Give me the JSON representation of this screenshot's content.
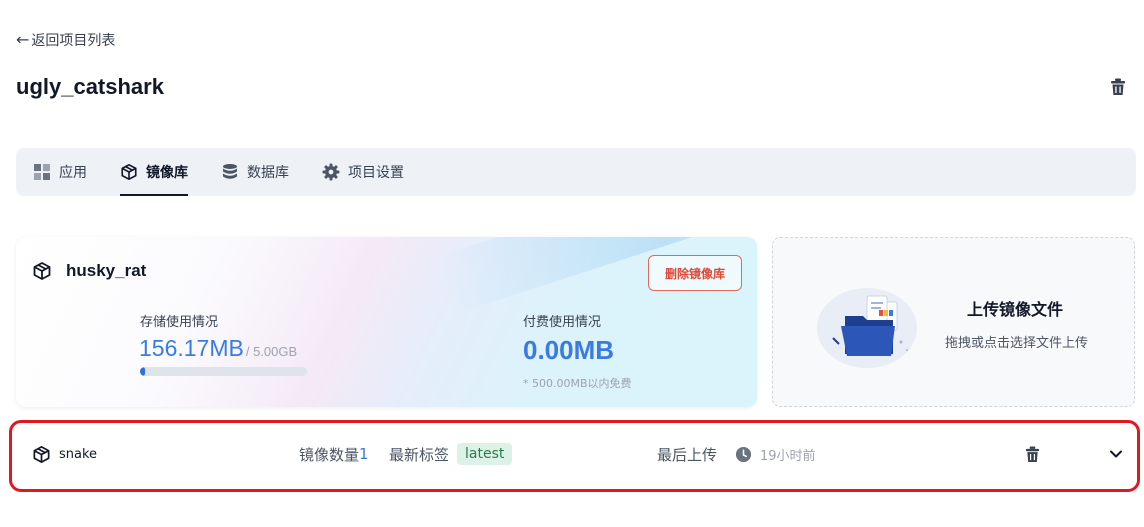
{
  "nav": {
    "back_label": "返回项目列表"
  },
  "project": {
    "name": "ugly_catshark"
  },
  "tabs": [
    {
      "label": "应用",
      "icon": "grid-icon",
      "active": false
    },
    {
      "label": "镜像库",
      "icon": "cube-icon",
      "active": true
    },
    {
      "label": "数据库",
      "icon": "database-icon",
      "active": false
    },
    {
      "label": "项目设置",
      "icon": "gear-icon",
      "active": false
    }
  ],
  "registry": {
    "name": "husky_rat",
    "delete_label": "删除镜像库",
    "storage": {
      "label": "存储使用情况",
      "used": "156.17MB",
      "limit": "/ 5.00GB",
      "fraction": 0.031
    },
    "billing": {
      "label": "付费使用情况",
      "value": "0.00MB",
      "note": "* 500.00MB以内免费"
    }
  },
  "upload": {
    "title": "上传镜像文件",
    "description": "拖拽或点击选择文件上传"
  },
  "image_row": {
    "name": "snake",
    "count_label": "镜像数量",
    "count": "1",
    "tag_label": "最新标签",
    "tag": "latest",
    "last_upload_label": "最后上传",
    "last_upload_time": "19小时前"
  },
  "colors": {
    "accent": "#3a7be0",
    "danger": "#dc4a38",
    "highlight": "#e0191f",
    "tag_bg": "#ddf2e6",
    "tag_text": "#2b7a4b"
  }
}
